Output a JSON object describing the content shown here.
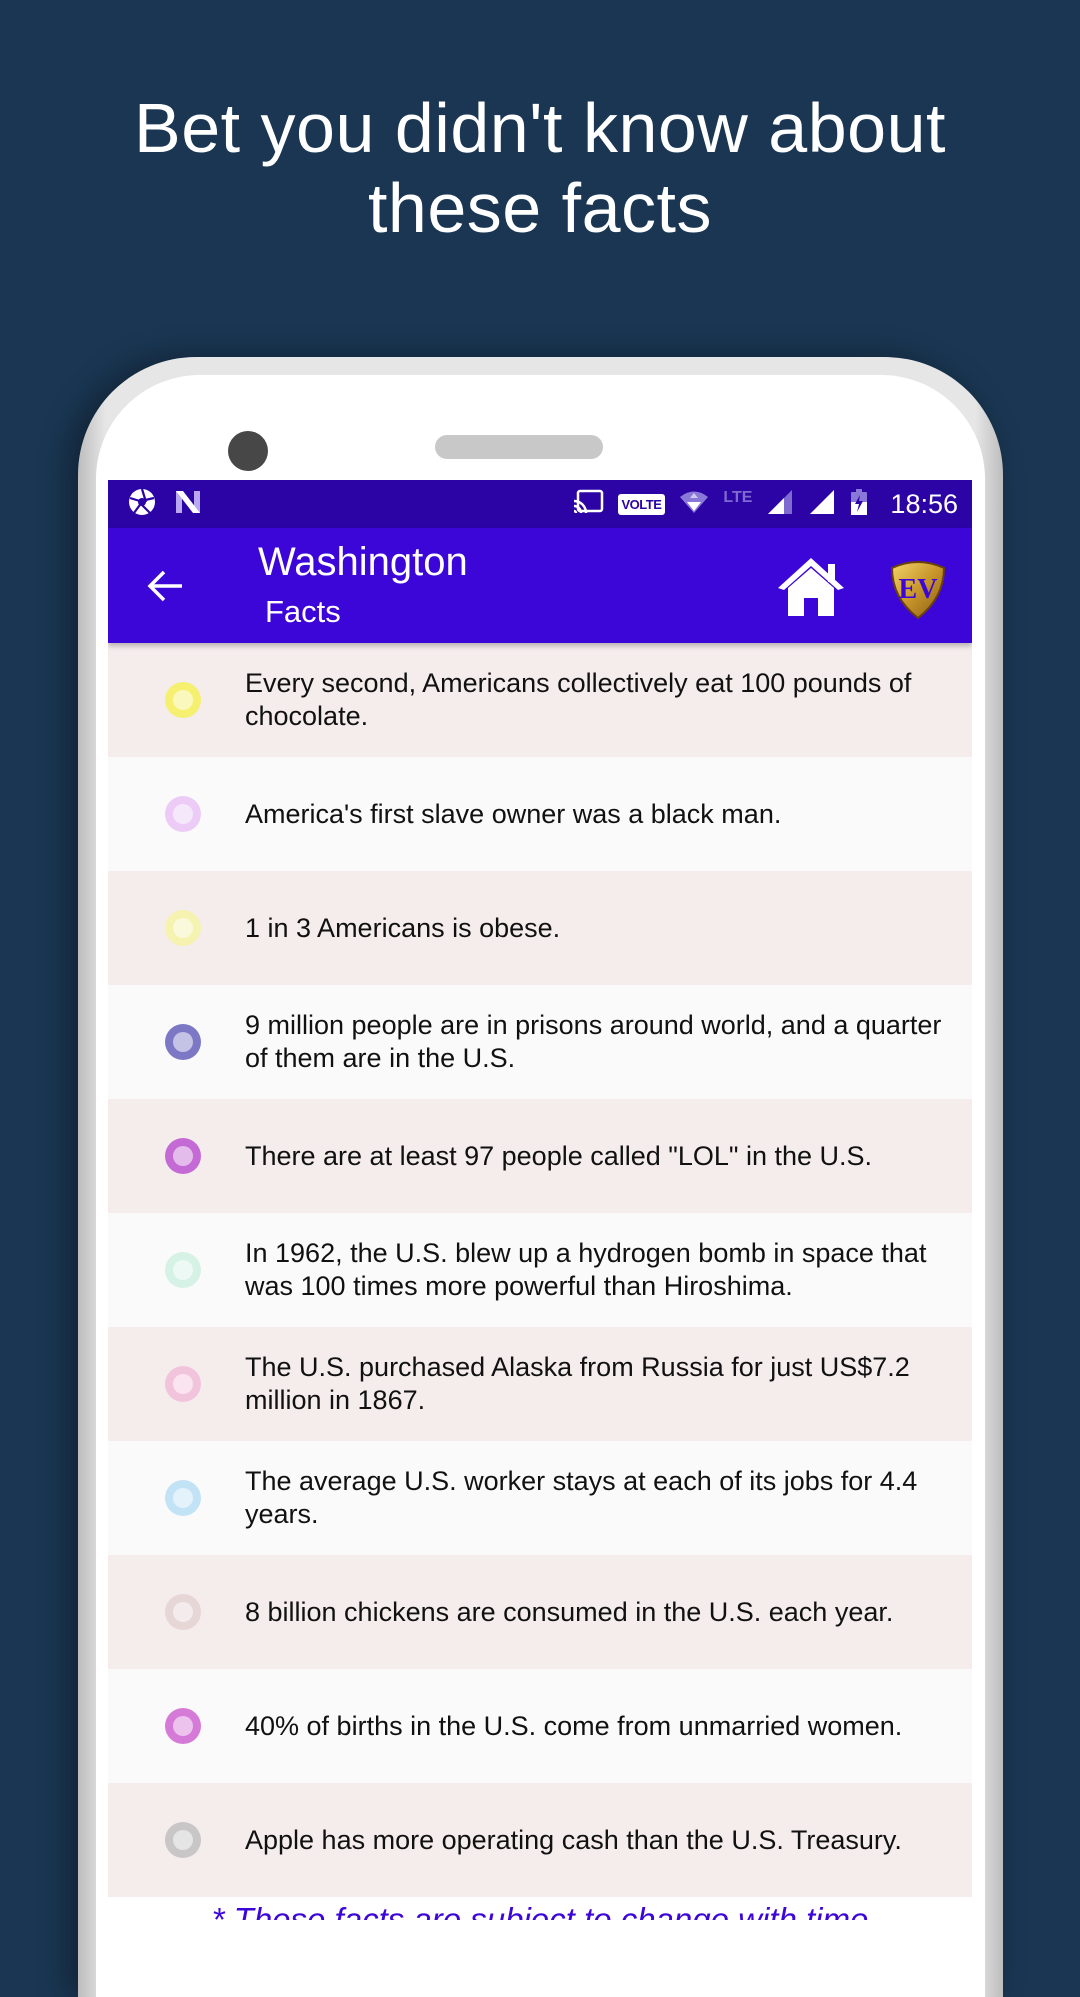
{
  "headline": {
    "line1": "Bet you didn't know about",
    "line2": "these facts"
  },
  "status_bar": {
    "left_icons": [
      "aperture-icon",
      "n-logo-icon"
    ],
    "right_icons": [
      "cast-icon",
      "volte-badge",
      "wifi-icon",
      "lte-icon",
      "signal-icon",
      "signal-icon",
      "battery-charging-icon"
    ],
    "volte_label": "VOLTE",
    "lte_label": "LTE",
    "time": "18:56"
  },
  "app_bar": {
    "title": "Washington",
    "subtitle": "Facts",
    "back_icon": "arrow-left-icon",
    "home_icon": "home-icon",
    "logo": "EV",
    "background": "#3d06d9"
  },
  "facts": [
    {
      "text": "Every second, Americans collectively eat 100 pounds of chocolate.",
      "dot_color": "#f6f070"
    },
    {
      "text": "America's first slave owner was a black man.",
      "dot_color": "#ecccf6"
    },
    {
      "text": "1 in 3 Americans is obese.",
      "dot_color": "#f6f2b0"
    },
    {
      "text": "9 million people are in prisons around world, and a quarter of them are in the U.S.",
      "dot_color": "#7c78c6"
    },
    {
      "text": "There are at least 97 people called \"LOL\" in the U.S.",
      "dot_color": "#c46ad4"
    },
    {
      "text": "In 1962, the U.S. blew up a hydrogen bomb in space that was 100 times more powerful than Hiroshima.",
      "dot_color": "#d6f2e6"
    },
    {
      "text": "The U.S. purchased Alaska from Russia for just US$7.2 million in 1867.",
      "dot_color": "#f2c4dc"
    },
    {
      "text": "The average U.S. worker stays at each of its jobs for 4.4 years.",
      "dot_color": "#c2e2f6"
    },
    {
      "text": "8 billion chickens are consumed in the U.S. each year.",
      "dot_color": "#e6d6d6"
    },
    {
      "text": "40% of births in the U.S. come from unmarried women.",
      "dot_color": "#d67ad8"
    },
    {
      "text": "Apple has more operating cash than the U.S. Treasury.",
      "dot_color": "#c8c6c6"
    }
  ],
  "footer_note": "* These facts are subject to change with time"
}
